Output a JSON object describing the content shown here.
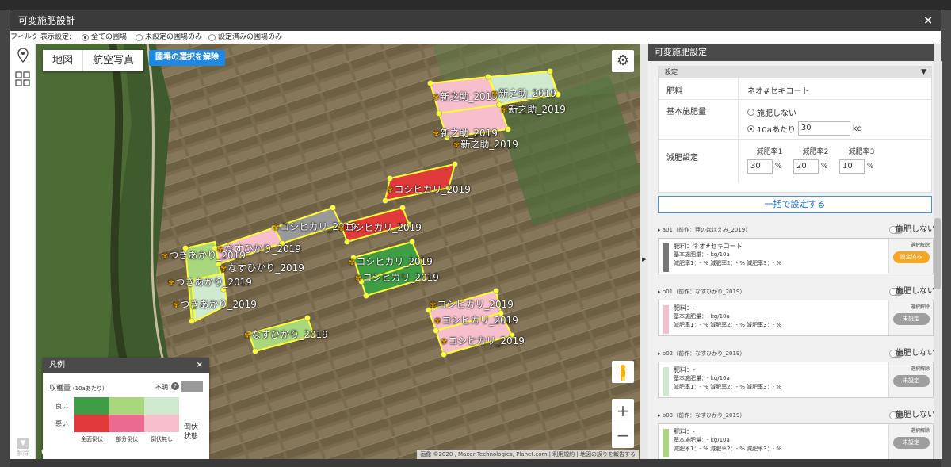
{
  "modal": {
    "title": "可変施肥設計",
    "close_icon": "×"
  },
  "filter": {
    "filter_label": "フィルタ",
    "display_label": "表示設定:",
    "options": [
      "全ての圃場",
      "未設定の圃場のみ",
      "設定済みの圃場のみ"
    ],
    "selected_index": 0
  },
  "sidebar": {
    "release_label": "解除"
  },
  "map": {
    "tabs": [
      "地図",
      "航空写真"
    ],
    "active_tab": "航空写真",
    "clear_selection_label": "圃場の選択を解除",
    "zoom_in": "+",
    "zoom_out": "−",
    "google_label": "Google",
    "attribution": [
      "画像 ©2020 , Maxar Technologies, Planet.com",
      "利用規約",
      "地図の誤りを報告する"
    ],
    "field_labels": [
      {
        "text": "新之助_2019"
      },
      {
        "text": "新之助_2019"
      },
      {
        "text": "新之助_2019"
      },
      {
        "text": "新之助_2019"
      },
      {
        "text": "新之助_2019"
      },
      {
        "text": "コシヒカリ_2019"
      },
      {
        "text": "コシヒカリ_2019"
      },
      {
        "text": "コシヒカリ_2019"
      },
      {
        "text": "コシヒカリ_2019"
      },
      {
        "text": "コシヒカリ_2019"
      },
      {
        "text": "コシヒカリ_2019"
      },
      {
        "text": "コシヒカリ_2019"
      },
      {
        "text": "コシヒカリ_2019"
      },
      {
        "text": "なすひかり_2019"
      },
      {
        "text": "なすひかり_2019"
      },
      {
        "text": "なすひかり_2019"
      },
      {
        "text": "つきあかり_2019"
      },
      {
        "text": "つきあかり_2019"
      },
      {
        "text": "つきあかり_2019"
      }
    ]
  },
  "legend": {
    "title": "凡例",
    "close_icon": "×",
    "yield_label": "収穫量",
    "per_area": "(10aあたり)",
    "unknown_label": "不明",
    "good": "良い",
    "bad": "悪い",
    "cols": [
      "全面倒伏",
      "部分倒伏",
      "倒伏無し"
    ],
    "lodging_label": "倒伏状態",
    "colors": {
      "good": [
        "#3f9e45",
        "#a9d77d",
        "#cfe9cf"
      ],
      "bad": [
        "#e03a3a",
        "#ea6a90",
        "#f7bfcc"
      ],
      "unknown": "#999999"
    }
  },
  "panel": {
    "title": "可変施肥設定",
    "settings_label": "設定",
    "fertilizer_key": "肥料",
    "fertilizer_value": "ネオ#セキコート",
    "base_amount_key": "基本施肥量",
    "no_fert_option": "施肥しない",
    "per10a_option": "10aあたり",
    "amount_value": "30",
    "unit": "kg",
    "reduction_key": "減肥設定",
    "reductions": [
      {
        "label": "減肥率1",
        "value": "30",
        "unit": "%"
      },
      {
        "label": "減肥率2",
        "value": "20",
        "unit": "%"
      },
      {
        "label": "減肥率3",
        "value": "10",
        "unit": "%"
      }
    ],
    "bulk_button": "一括で設定する",
    "cards": [
      {
        "header": "a01（前作：亜のほほえみ_2019）",
        "toggle": "施肥しない",
        "color": "#777777",
        "fert": "肥料：ネオ#セキコート",
        "base": "基本施肥量：- kg/10a",
        "rates": "減肥率1：- %   減肥率2：- %   減肥率3：- %",
        "select_clear": "選択解除",
        "status": "設定済み",
        "status_color": "#f5a623"
      },
      {
        "header": "b01（前作：なすひかり_2019）",
        "toggle": "施肥しない",
        "color": "#f7bfcc",
        "fert": "肥料：-",
        "base": "基本施肥量：- kg/10a",
        "rates": "減肥率1：- %   減肥率2：- %   減肥率3：- %",
        "select_clear": "選択解除",
        "status": "未設定",
        "status_color": "#9e9e9e"
      },
      {
        "header": "b02（前作：なすひかり_2019）",
        "toggle": "施肥しない",
        "color": "#cfe9cf",
        "fert": "肥料：-",
        "base": "基本施肥量：- kg/10a",
        "rates": "減肥率1：- %   減肥率2：- %   減肥率3：- %",
        "select_clear": "選択解除",
        "status": "未設定",
        "status_color": "#9e9e9e"
      },
      {
        "header": "b03（前作：なすひかり_2019）",
        "toggle": "施肥しない",
        "color": "#a9d77d",
        "fert": "肥料：-",
        "base": "基本施肥量：- kg/10a",
        "rates": "減肥率1：- %   減肥率2：- %   減肥率3：- %",
        "select_clear": "選択解除",
        "status": "未設定",
        "status_color": "#9e9e9e"
      }
    ]
  }
}
